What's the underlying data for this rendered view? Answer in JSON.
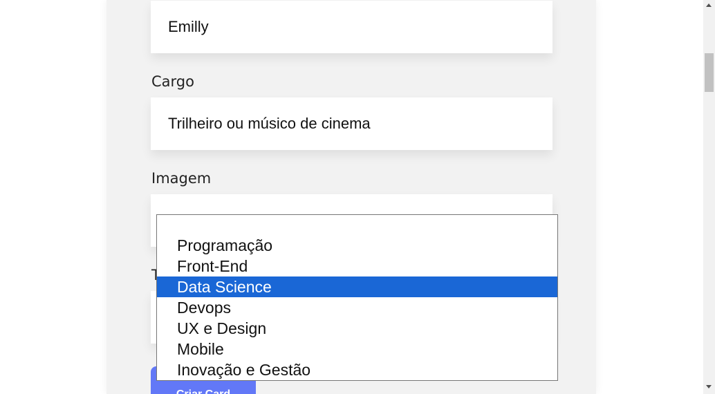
{
  "form": {
    "name_value": "Emilly",
    "cargo_label": "Cargo",
    "cargo_value": "Trilheiro ou músico de cinema",
    "imagem_label": "Imagem",
    "time_label_partial": "T",
    "submit_label": "Criar Card"
  },
  "dropdown": {
    "options": [
      {
        "label": "Programação",
        "selected": false
      },
      {
        "label": "Front-End",
        "selected": false
      },
      {
        "label": "Data Science",
        "selected": true
      },
      {
        "label": "Devops",
        "selected": false
      },
      {
        "label": "UX e Design",
        "selected": false
      },
      {
        "label": "Mobile",
        "selected": false
      },
      {
        "label": "Inovação e Gestão",
        "selected": false
      }
    ]
  },
  "colors": {
    "selected_option": "#1a67d6",
    "submit_button": "#6278f7",
    "panel_background": "#f2f2f2"
  }
}
